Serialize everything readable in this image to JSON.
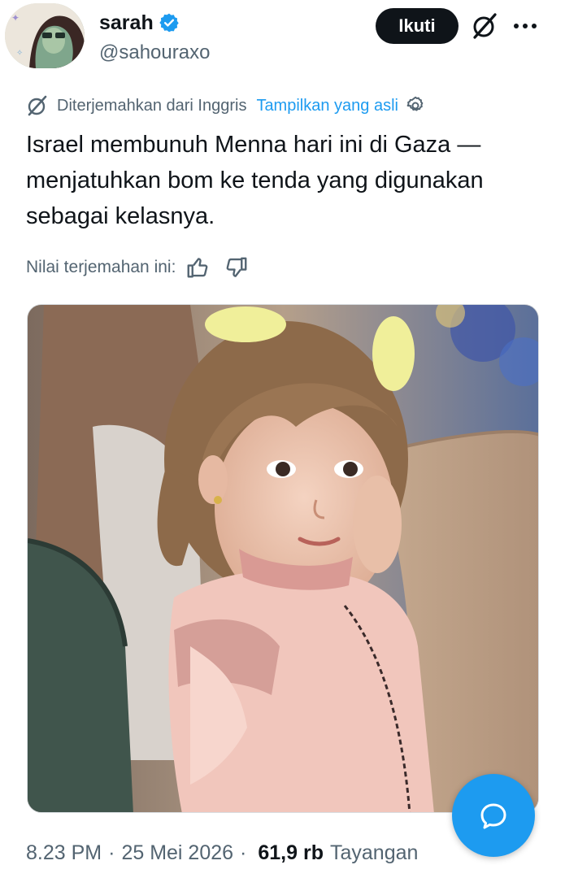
{
  "user": {
    "display_name": "sarah",
    "handle": "@sahouraxo",
    "verified": true
  },
  "header": {
    "follow_label": "Ikuti",
    "grok_icon": "grok-icon",
    "more_icon": "more-icon"
  },
  "translation": {
    "translated_from": "Diterjemahkan dari Inggris",
    "show_original": "Tampilkan yang asli"
  },
  "tweet": {
    "text": "Israel membunuh Menna hari ini di Gaza —\nmenjatuhkan bom ke tenda yang digunakan\nsebagai kelasnya."
  },
  "rating": {
    "label": "Nilai terjemahan ini:"
  },
  "meta": {
    "time": "8.23 PM",
    "date": "25 Mei 2026",
    "views_count": "61,9 rb",
    "views_label": "Tayangan"
  },
  "colors": {
    "accent": "#1d9bf0",
    "text": "#0f1419",
    "secondary": "#536471",
    "button_bg": "#0f1419"
  }
}
